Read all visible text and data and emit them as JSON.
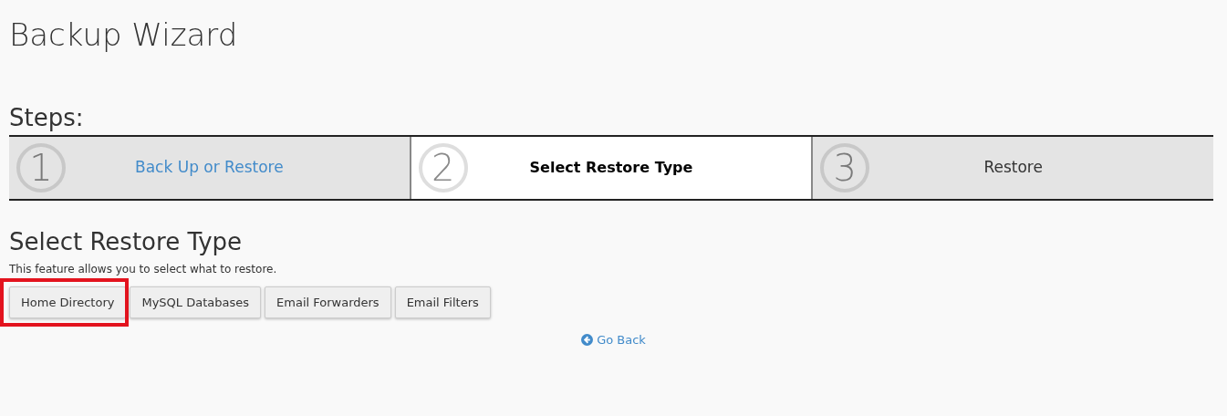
{
  "page_title": "Backup Wizard",
  "steps_label": "Steps:",
  "steps": [
    {
      "number": "1",
      "label": "Back Up or Restore",
      "completed": true,
      "selected": false
    },
    {
      "number": "2",
      "label": "Select Restore Type",
      "completed": false,
      "selected": true
    },
    {
      "number": "3",
      "label": "Restore",
      "completed": false,
      "selected": false
    }
  ],
  "section": {
    "heading": "Select Restore Type",
    "description": "This feature allows you to select what to restore."
  },
  "buttons": [
    {
      "label": "Home Directory",
      "highlighted": true
    },
    {
      "label": "MySQL Databases",
      "highlighted": false
    },
    {
      "label": "Email Forwarders",
      "highlighted": false
    },
    {
      "label": "Email Filters",
      "highlighted": false
    }
  ],
  "back_link": "Go Back"
}
